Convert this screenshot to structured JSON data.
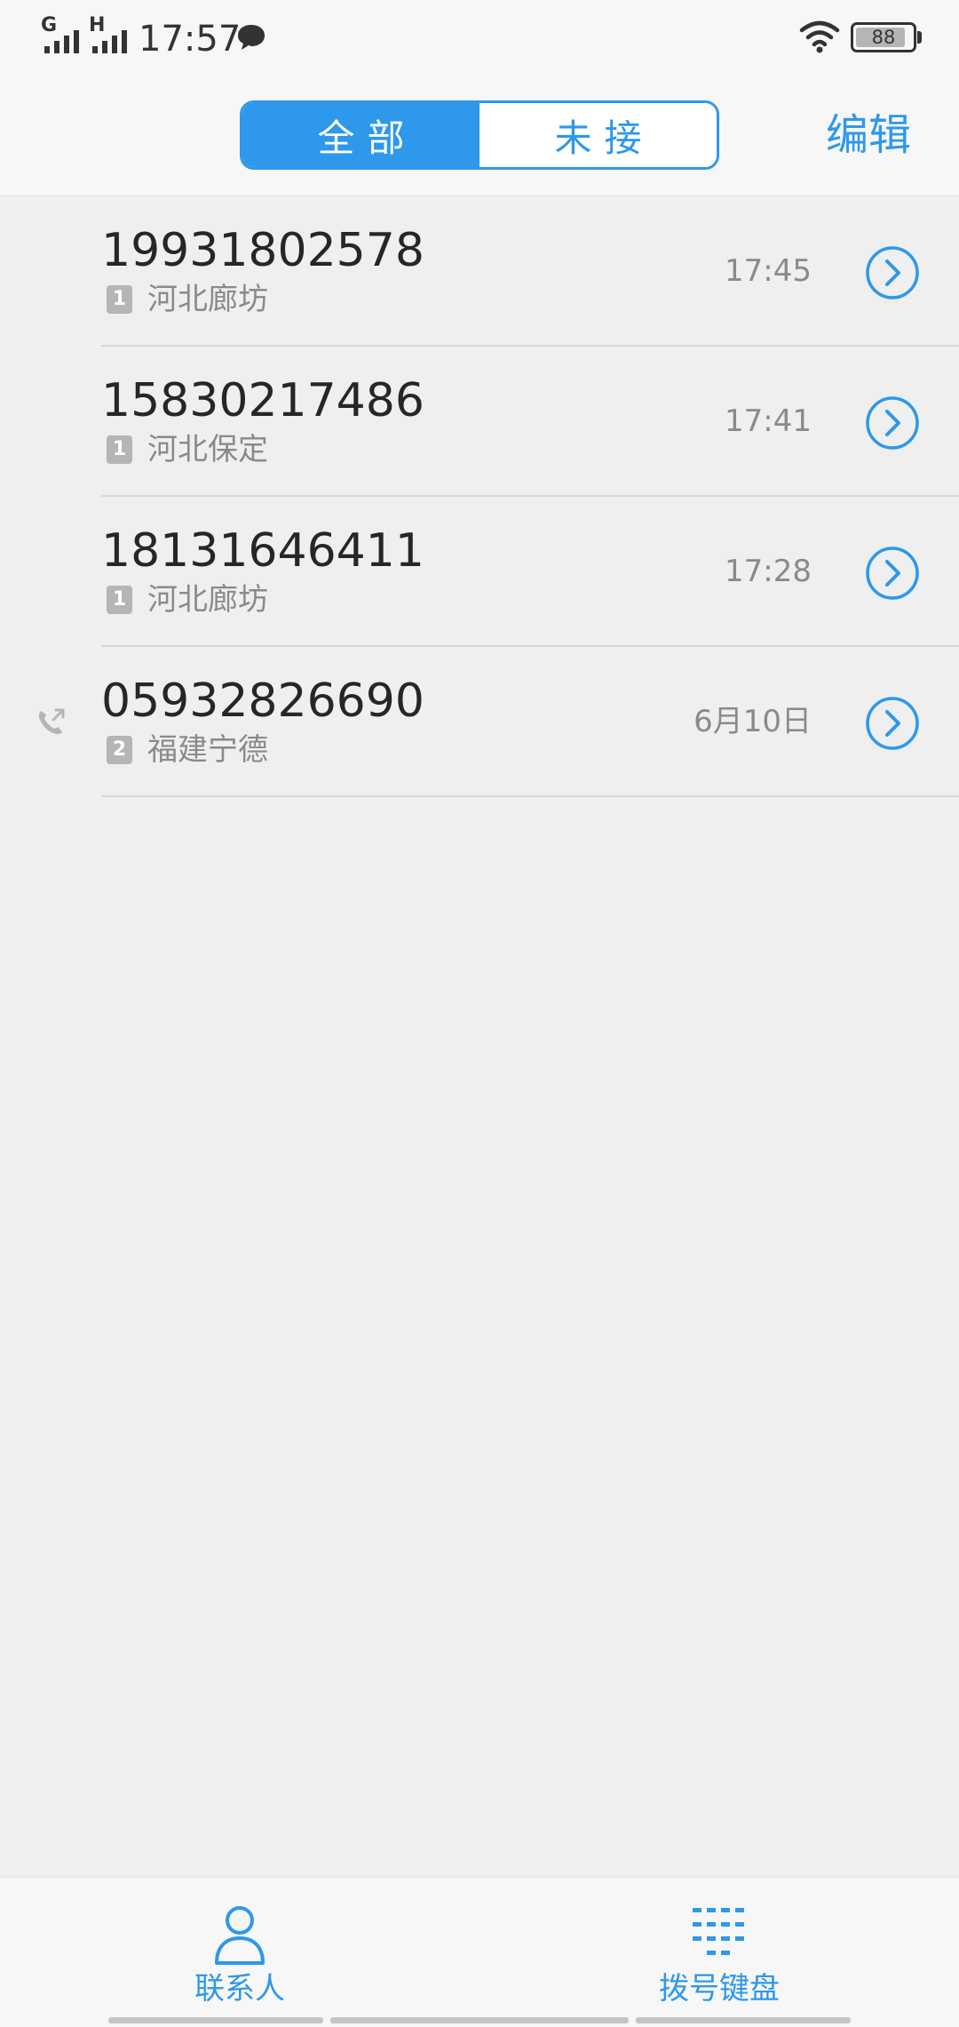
{
  "status_bar": {
    "sim1_network": "G",
    "sim2_network": "H",
    "time": "17:57",
    "battery_level": "88",
    "icons": [
      "signal-icon",
      "message-icon",
      "wifi-icon",
      "battery-icon"
    ]
  },
  "header": {
    "tabs": [
      {
        "label": "全部",
        "active": true
      },
      {
        "label": "未接",
        "active": false
      }
    ],
    "edit_label": "编辑"
  },
  "calls": [
    {
      "number": "19931802578",
      "sim": "1",
      "location": "河北廊坊",
      "time": "17:45",
      "outgoing": false
    },
    {
      "number": "15830217486",
      "sim": "1",
      "location": "河北保定",
      "time": "17:41",
      "outgoing": false
    },
    {
      "number": "18131646411",
      "sim": "1",
      "location": "河北廊坊",
      "time": "17:28",
      "outgoing": false
    },
    {
      "number": "05932826690",
      "sim": "2",
      "location": "福建宁德",
      "time": "6月10日",
      "outgoing": true
    }
  ],
  "bottom_nav": {
    "contacts_label": "联系人",
    "dialpad_label": "拨号键盘"
  },
  "colors": {
    "accent": "#2e98ea",
    "background": "#efefef",
    "bar_background": "#f7f7f7",
    "secondary_text": "#8a8a8a"
  }
}
